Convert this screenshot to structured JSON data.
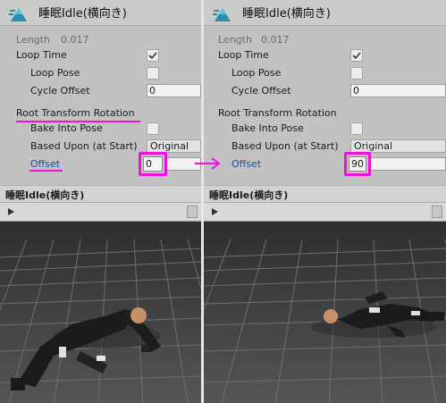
{
  "colors": {
    "highlight": "#ee11dd",
    "inspector_bg": "#c2c2c2",
    "link_blue": "#1a4fa8"
  },
  "icons": {
    "header": "unity-animation-clip-icon",
    "play": "play-icon",
    "transition": "arrow-right-icon"
  },
  "left": {
    "title": "睡眠Idle(横向き)",
    "length_label": "Length",
    "length_value": "0.017",
    "loop_time_label": "Loop Time",
    "loop_time_checked": true,
    "loop_pose_label": "Loop Pose",
    "cycle_offset_label": "Cycle Offset",
    "cycle_offset_value": "0",
    "root_rotation_label": "Root Transform Rotation",
    "bake_label": "Bake Into Pose",
    "based_upon_label": "Based Upon (at Start)",
    "based_upon_value": "Original",
    "offset_label": "Offset",
    "offset_value": "0",
    "preview_title": "睡眠Idle(横向き)"
  },
  "right": {
    "title": "睡眠Idle(横向き)",
    "length_label": "Length",
    "length_value": "0.017",
    "loop_time_label": "Loop Time",
    "loop_time_checked": true,
    "loop_pose_label": "Loop Pose",
    "cycle_offset_label": "Cycle Offset",
    "cycle_offset_value": "0",
    "root_rotation_label": "Root Transform Rotation",
    "bake_label": "Bake Into Pose",
    "based_upon_label": "Based Upon (at Start)",
    "based_upon_value": "Original",
    "offset_label": "Offset",
    "offset_value": "90",
    "preview_title": "睡眠Idle(横向き)"
  }
}
